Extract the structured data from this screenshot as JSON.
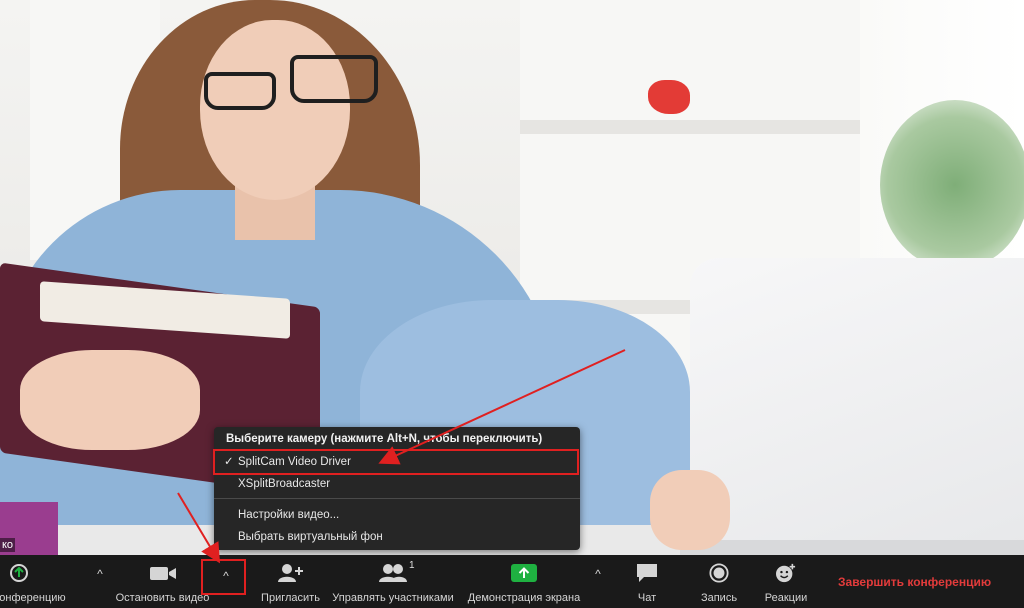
{
  "video": {
    "participant_label": "ко"
  },
  "camera_menu": {
    "header": "Выберите камеру (нажмите Alt+N, чтобы переключить)",
    "items": [
      {
        "label": "SplitCam Video Driver",
        "checked": true
      },
      {
        "label": "XSplitBroadcaster",
        "checked": false
      }
    ],
    "settings_items": [
      {
        "label": "Настройки видео..."
      },
      {
        "label": "Выбрать виртуальный фон"
      }
    ],
    "check_glyph": "✓"
  },
  "toolbar": {
    "join_audio_label": "конференцию",
    "audio_caret": "^",
    "stop_video_label": "Остановить видео",
    "video_caret": "^",
    "invite_label": "Пригласить",
    "participants_label": "Управлять участниками",
    "participants_count": "1",
    "share_label": "Демонстрация экрана",
    "share_caret": "^",
    "chat_label": "Чат",
    "record_label": "Запись",
    "reactions_label": "Реакции",
    "end_label": "Завершить конференцию"
  },
  "colors": {
    "toolbar_bg": "#1a1a1a",
    "menu_bg": "#262626",
    "share_green": "#1fb141",
    "end_red": "#e23b3b",
    "annotation_red": "#e02020"
  },
  "icons": [
    "audio-icon",
    "camera-icon",
    "invite-icon",
    "participants-icon",
    "share-screen-icon",
    "chat-icon",
    "record-icon",
    "reactions-icon"
  ]
}
